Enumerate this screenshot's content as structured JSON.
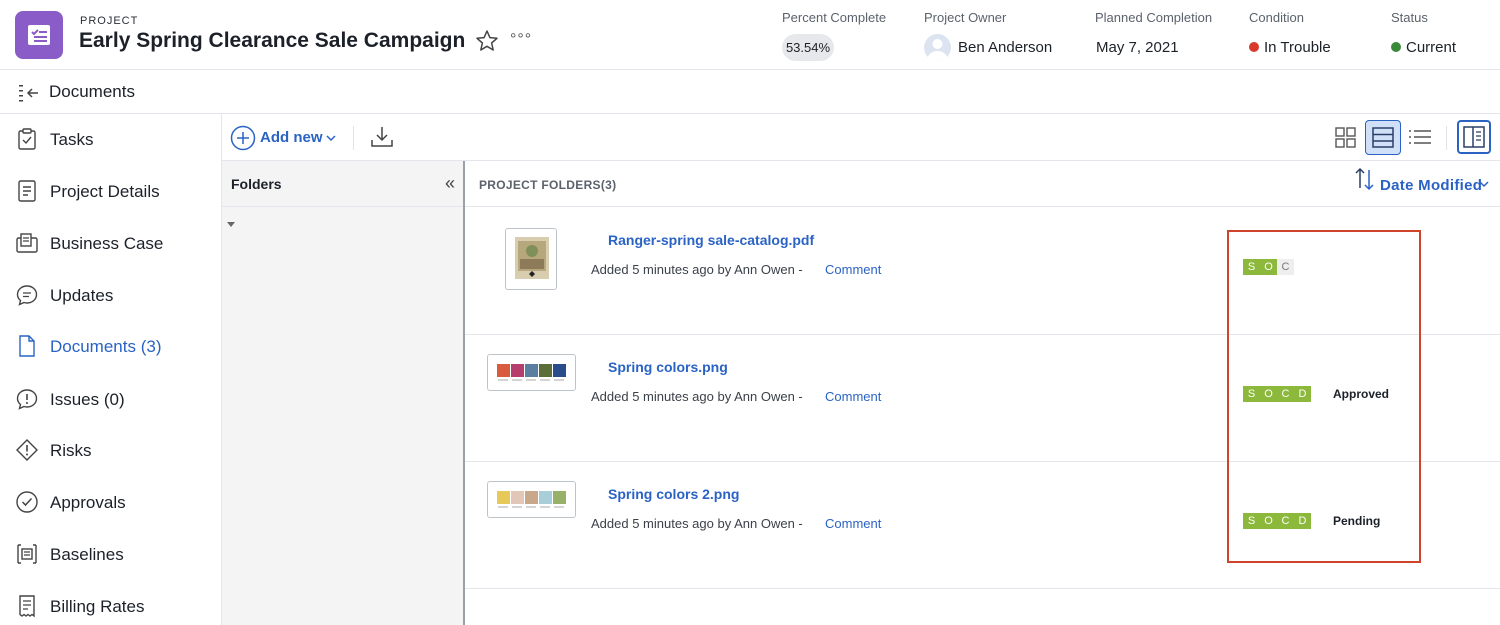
{
  "header": {
    "label": "PROJECT",
    "title": "Early Spring Clearance Sale Campaign",
    "more_label": "°°°",
    "percent_complete": {
      "label": "Percent Complete",
      "value": "53.54%"
    },
    "project_owner": {
      "label": "Project Owner",
      "value": "Ben Anderson"
    },
    "planned_completion": {
      "label": "Planned Completion",
      "value": "May 7, 2021"
    },
    "condition": {
      "label": "Condition",
      "value": "In Trouble",
      "color": "#d93a2b"
    },
    "status": {
      "label": "Status",
      "value": "Current",
      "color": "#3a8a3a"
    }
  },
  "subheader": {
    "title": "Documents"
  },
  "sidebar": {
    "items": [
      {
        "label": "Tasks",
        "icon": "clipboard-check-icon"
      },
      {
        "label": "Project Details",
        "icon": "document-lines-icon"
      },
      {
        "label": "Business Case",
        "icon": "briefcase-doc-icon"
      },
      {
        "label": "Updates",
        "icon": "chat-bubble-icon"
      },
      {
        "label": "Documents (3)",
        "icon": "document-icon",
        "active": true
      },
      {
        "label": "Issues (0)",
        "icon": "alert-bubble-icon"
      },
      {
        "label": "Risks",
        "icon": "diamond-alert-icon"
      },
      {
        "label": "Approvals",
        "icon": "check-circle-icon"
      },
      {
        "label": "Baselines",
        "icon": "baseline-icon"
      },
      {
        "label": "Billing Rates",
        "icon": "receipt-icon"
      }
    ]
  },
  "toolbar": {
    "add_new": "Add new"
  },
  "folders": {
    "title": "Folders",
    "collapse": "«"
  },
  "list": {
    "header": "PROJECT FOLDERS(3)",
    "sort_label": "Date Modified",
    "documents": [
      {
        "name": "Ranger-spring sale-catalog.pdf",
        "meta": "Added 5 minutes ago by Ann Owen -",
        "comment": "Comment",
        "socd": [
          "S",
          "O",
          "C"
        ],
        "socd_active": 2,
        "status": ""
      },
      {
        "name": "Spring colors.png",
        "meta": "Added 5 minutes ago by Ann Owen -",
        "comment": "Comment",
        "socd": [
          "S",
          "O",
          "C",
          "D"
        ],
        "socd_active": 4,
        "status": "Approved"
      },
      {
        "name": "Spring colors 2.png",
        "meta": "Added 5 minutes ago by Ann Owen -",
        "comment": "Comment",
        "socd": [
          "S",
          "O",
          "C",
          "D"
        ],
        "socd_active": 4,
        "status": "Pending"
      }
    ]
  },
  "colors": {
    "accent": "#2a63c4",
    "project_icon": "#8a5cc7",
    "socd_on": "#8cb83c",
    "highlight": "#d0432b"
  }
}
